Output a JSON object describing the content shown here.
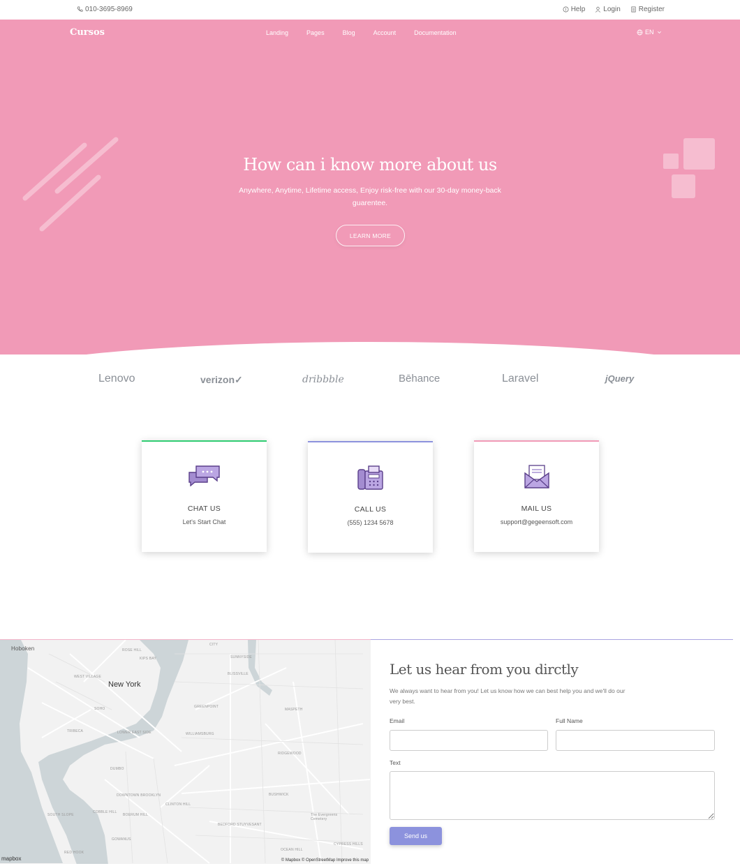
{
  "topbar": {
    "phone": "010-3695-8969",
    "help": "Help",
    "login": "Login",
    "register": "Register"
  },
  "nav": {
    "brand": "Cursos",
    "items": [
      "Landing",
      "Pages",
      "Blog",
      "Account",
      "Documentation"
    ],
    "lang": "EN"
  },
  "hero": {
    "title": "How can i know more about us",
    "subtitle": "Anywhere, Anytime, Lifetime access, Enjoy risk-free with our 30-day money-back guarentee.",
    "button": "LEARN MORE",
    "bg_color": "#f19ab7"
  },
  "logos": [
    "Lenovo",
    "verizon✓",
    "dribbble",
    "Bēhance",
    "Laravel",
    "jQuery"
  ],
  "cards": [
    {
      "title": "CHAT US",
      "text": "Let's Start Chat",
      "icon": "chat-bubbles-icon",
      "accent": "#2ecc71"
    },
    {
      "title": "CALL US",
      "text": "(555) 1234 5678",
      "icon": "fax-phone-icon",
      "accent": "#8c92dd"
    },
    {
      "title": "MAIL US",
      "text": "support@gegeensoft.com",
      "icon": "envelope-icon",
      "accent": "#f19ab7"
    }
  ],
  "map": {
    "city": "New York",
    "labels": {
      "hoboken": "Hoboken",
      "rose_hill": "ROSE HILL",
      "kips_bay": "KIPS BAY",
      "west_village": "WEST VILLAGE",
      "soho": "SOHO",
      "tribeca": "TRIBECA",
      "greenpoint": "GREENPOINT",
      "williamsburg": "WILLIAMSBURG",
      "dumbo": "DUMBO",
      "ridgewood": "RIDGEWOOD",
      "bushwick": "BUSHWICK",
      "bedford": "BEDFORD STUYVESANT",
      "maspeth": "MASPETH",
      "cobble_hill": "COBBLE HILL",
      "red_hook": "RED HOOK",
      "park_slope": "SOUTH SLOPE",
      "sunnyside": "SUNNYSIDE",
      "city": "CITY",
      "blissville": "BLISSVILLE",
      "lower_east": "LOWER EAST SIDE",
      "downtown_bk": "DOWNTOWN BROOKLYN",
      "boerum": "BOERUM HILL",
      "clinton_hill": "CLINTON HILL",
      "gowanus": "GOWANUS",
      "evergreens": "The Evergreens Cemetery",
      "cypress": "CYPRESS HILLS",
      "ocean_hill": "OCEAN HILL"
    },
    "attribution": "© Mapbox © OpenStreetMap  Improve this map",
    "mapbox": "mapbox"
  },
  "form": {
    "title": "Let us hear from you dirctly",
    "intro": "We always want to hear from you! Let us know how we can best help you and we'll do our very best.",
    "email_label": "Email",
    "name_label": "Full Name",
    "text_label": "Text",
    "email_value": "",
    "name_value": "",
    "text_value": "",
    "submit": "Send us",
    "submit_color": "#8c92dd"
  }
}
